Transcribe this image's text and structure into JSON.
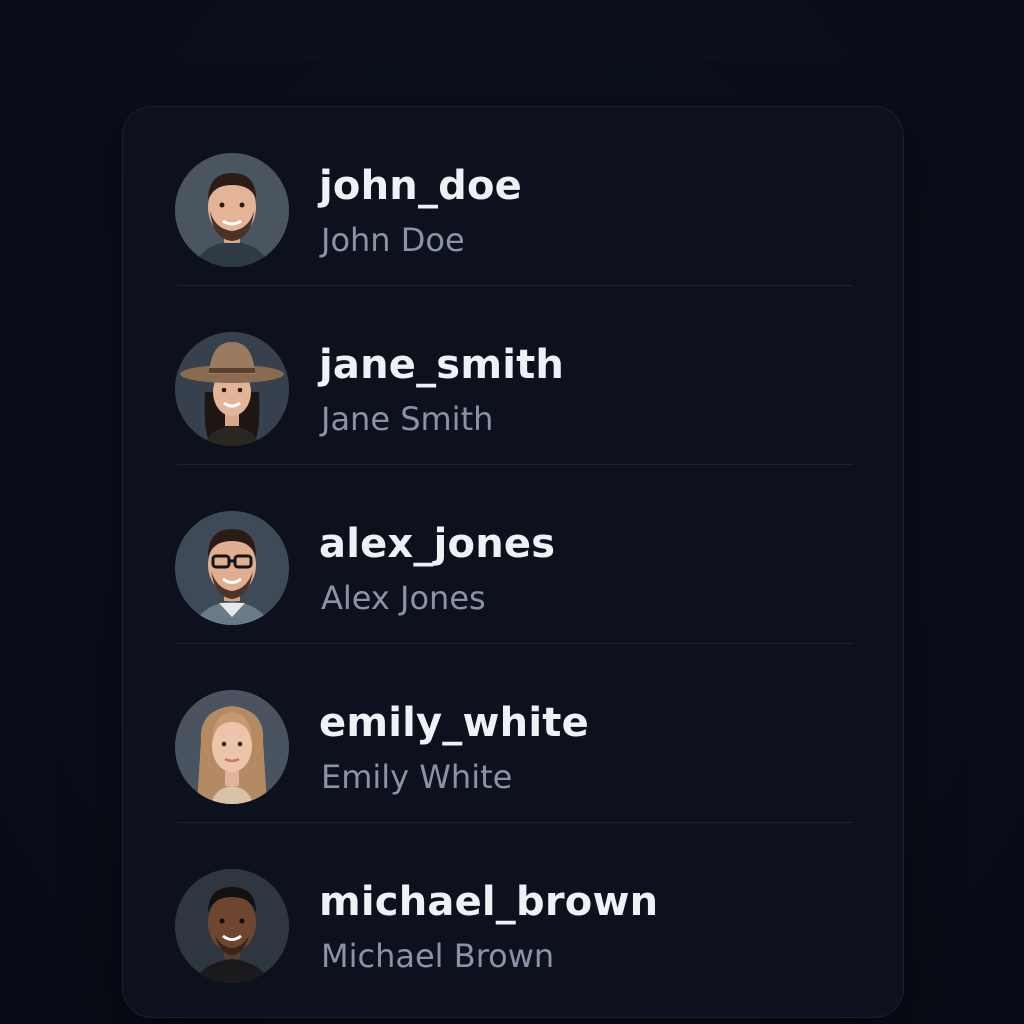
{
  "users": [
    {
      "username": "john_doe",
      "name": "John Doe",
      "avatar_icon": "avatar-man-beard-icon"
    },
    {
      "username": "jane_smith",
      "name": "Jane Smith",
      "avatar_icon": "avatar-woman-hat-icon"
    },
    {
      "username": "alex_jones",
      "name": "Alex Jones",
      "avatar_icon": "avatar-man-glasses-icon"
    },
    {
      "username": "emily_white",
      "name": "Emily White",
      "avatar_icon": "avatar-woman-long-hair-icon"
    },
    {
      "username": "michael_brown",
      "name": "Michael Brown",
      "avatar_icon": "avatar-man-short-hair-icon"
    }
  ],
  "colors": {
    "background": "#0b0f1a",
    "card": "#0c111d",
    "username_text": "#eef1f6",
    "name_text": "#8893a8",
    "divider": "#1c2232"
  }
}
